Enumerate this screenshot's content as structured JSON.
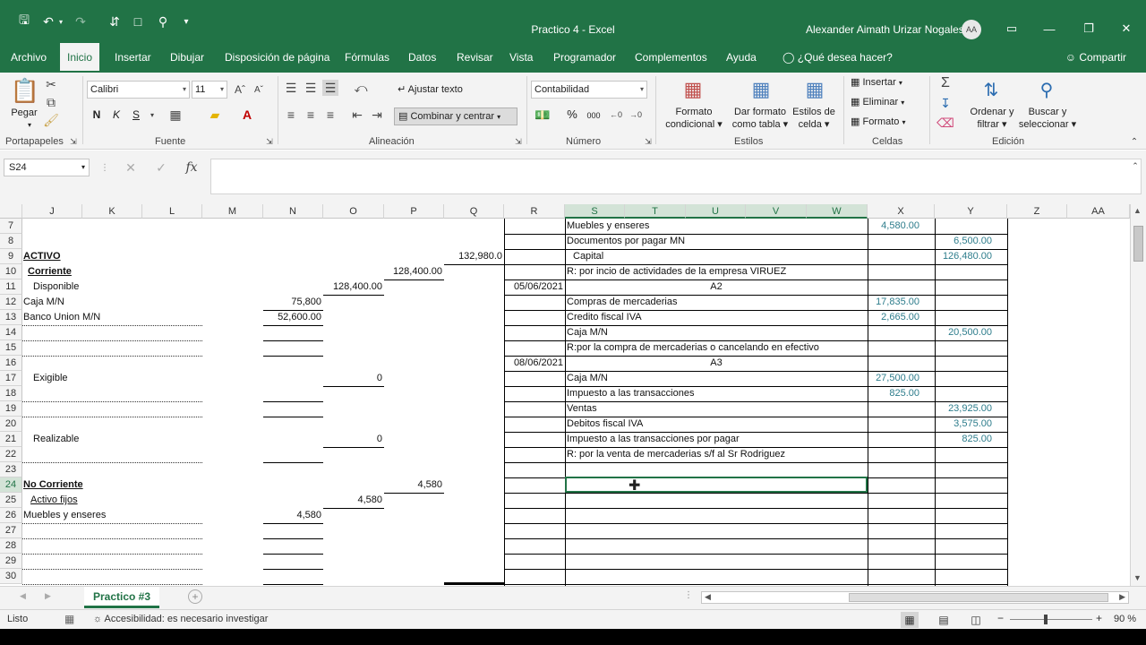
{
  "window": {
    "title": "Practico 4  -  Excel",
    "user": "Alexander Aimath Urizar Nogales",
    "initials": "AA"
  },
  "tabs": [
    "Archivo",
    "Inicio",
    "Insertar",
    "Dibujar",
    "Disposición de página",
    "Fórmulas",
    "Datos",
    "Revisar",
    "Vista",
    "Programador",
    "Complementos",
    "Ayuda"
  ],
  "tell_me": "¿Qué desea hacer?",
  "share": "Compartir",
  "ribbon": {
    "paste": "Pegar",
    "font_name": "Calibri",
    "font_size": "11",
    "bold": "N",
    "italic": "K",
    "underline": "S",
    "wrap_text": "Ajustar texto",
    "merge_center": "Combinar y centrar",
    "number_format": "Contabilidad",
    "percent": "%",
    "thousands": "000",
    "cond_format_1": "Formato",
    "cond_format_2": "condicional",
    "format_table_1": "Dar formato",
    "format_table_2": "como tabla",
    "cell_styles_1": "Estilos de",
    "cell_styles_2": "celda",
    "insert": "Insertar",
    "delete": "Eliminar",
    "format": "Formato",
    "sort_1": "Ordenar y",
    "sort_2": "filtrar",
    "find_1": "Buscar y",
    "find_2": "seleccionar",
    "groups": {
      "clipboard": "Portapapeles",
      "font": "Fuente",
      "alignment": "Alineación",
      "number": "Número",
      "styles": "Estilos",
      "cells": "Celdas",
      "editing": "Edición"
    }
  },
  "formula_bar": {
    "name_box": "S24",
    "fx": "fx",
    "value": ""
  },
  "columns": [
    "J",
    "K",
    "L",
    "M",
    "N",
    "O",
    "P",
    "Q",
    "R",
    "S",
    "T",
    "U",
    "V",
    "W",
    "X",
    "Y",
    "Z",
    "AA"
  ],
  "rows": [
    "7",
    "8",
    "9",
    "10",
    "11",
    "12",
    "13",
    "14",
    "15",
    "16",
    "17",
    "18",
    "19",
    "20",
    "21",
    "22",
    "23",
    "24",
    "25",
    "26",
    "27",
    "28",
    "29",
    "30"
  ],
  "cells": {
    "r7": {
      "desc": "Muebles y enseres",
      "debe": "4,580.00"
    },
    "r8": {
      "desc": "Documentos por pagar MN",
      "haber": "6,500.00"
    },
    "r9": {
      "label": "ACTIVO",
      "q": "132,980.0",
      "desc": "Capital",
      "haber": "126,480.00"
    },
    "r10": {
      "label": "Corriente",
      "p": "128,400.00",
      "desc": "R: por incio de actividades de la empresa VIRUEZ"
    },
    "r11": {
      "label": "Disponible",
      "o": "128,400.00",
      "date": "05/06/2021",
      "desc": "A2"
    },
    "r12": {
      "label": "Caja M/N",
      "n": "75,800",
      "desc": "Compras de mercaderias",
      "debe": "17,835.00"
    },
    "r13": {
      "label": "Banco Union M/N",
      "n": "52,600.00",
      "desc": "Credito fiscal IVA",
      "debe": "2,665.00"
    },
    "r14": {
      "desc": "Caja M/N",
      "haber": "20,500.00"
    },
    "r15": {
      "desc": "R:por la compra de mercaderias o cancelando en efectivo"
    },
    "r16": {
      "date": "08/06/2021",
      "desc": "A3"
    },
    "r17": {
      "label": "Exigible",
      "o": "0",
      "desc": "Caja M/N",
      "debe": "27,500.00"
    },
    "r18": {
      "desc": "Impuesto a las transacciones",
      "debe": "825.00"
    },
    "r19": {
      "desc": "Ventas",
      "haber": "23,925.00"
    },
    "r20": {
      "desc": "Debitos fiscal IVA",
      "haber": "3,575.00"
    },
    "r21": {
      "label": "Realizable",
      "o": "0",
      "desc": "Impuesto a las transacciones por pagar",
      "haber": "825.00"
    },
    "r22": {
      "desc": "R: por la venta de mercaderias s/f al Sr Rodriguez"
    },
    "r24": {
      "label": "No Corriente",
      "p": "4,580"
    },
    "r25": {
      "label": "Activo fijos",
      "o": "4,580"
    },
    "r26": {
      "label": "Muebles y enseres",
      "n": "4,580"
    }
  },
  "sheet_tab": "Practico #3",
  "status": {
    "ready": "Listo",
    "accessibility": "Accesibilidad: es necesario investigar",
    "zoom": "90 %"
  }
}
